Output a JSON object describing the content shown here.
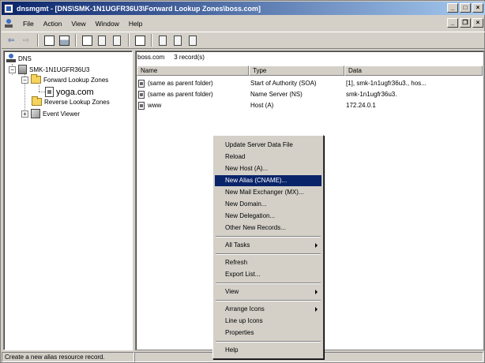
{
  "window": {
    "title": "dnsmgmt - [DNS\\SMK-1N1UGFR36U3\\Forward Lookup Zones\\boss.com]"
  },
  "menubar": {
    "items": [
      "File",
      "Action",
      "View",
      "Window",
      "Help"
    ]
  },
  "tree": {
    "root": "DNS",
    "server": "SMK-1N1UGFR36U3",
    "forward_zones": "Forward Lookup Zones",
    "zone": "yoga.com",
    "reverse_zones": "Reverse Lookup Zones",
    "event_viewer": "Event Viewer"
  },
  "list": {
    "zone_name": "boss.com",
    "record_count": "3 record(s)",
    "columns": [
      "Name",
      "Type",
      "Data"
    ],
    "rows": [
      {
        "name": "(same as parent folder)",
        "type": "Start of Authority (SOA)",
        "data": "[1], smk-1n1ugfr36u3., hos..."
      },
      {
        "name": "(same as parent folder)",
        "type": "Name Server (NS)",
        "data": "smk-1n1ugfr36u3."
      },
      {
        "name": "www",
        "type": "Host (A)",
        "data": "172.24.0.1"
      }
    ]
  },
  "context_menu": {
    "items": [
      "Update Server Data File",
      "Reload",
      "New Host (A)...",
      "New Alias (CNAME)...",
      "New Mail Exchanger (MX)...",
      "New Domain...",
      "New Delegation...",
      "Other New Records...",
      "All Tasks",
      "Refresh",
      "Export List...",
      "View",
      "Arrange Icons",
      "Line up Icons",
      "Properties",
      "Help"
    ],
    "highlighted": "New Alias (CNAME)..."
  },
  "statusbar": {
    "text": "Create a new alias resource record."
  },
  "colors": {
    "highlight": "#0a246a",
    "face": "#d4d0c8"
  }
}
